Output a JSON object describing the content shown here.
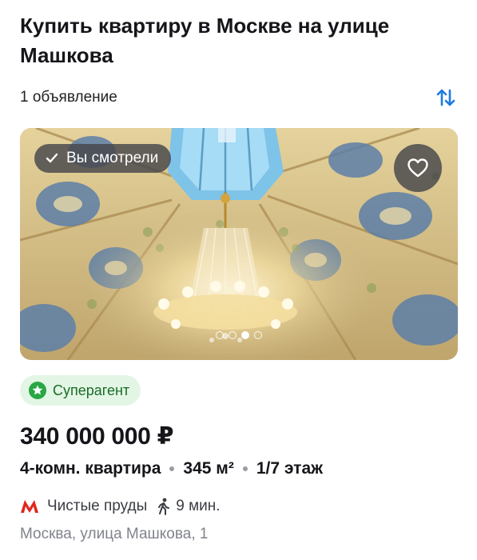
{
  "header": {
    "title": "Купить квартиру в Москве на улице Машкова",
    "count": "1 объявление"
  },
  "listing": {
    "seen_label": "Вы смотрели",
    "photo_dots_total": 4,
    "photo_dots_active": 2,
    "agent_badge": "Суперагент",
    "price": "340 000 000 ₽",
    "rooms": "4-комн. квартира",
    "area": "345 м²",
    "floor": "1/7 этаж",
    "metro_station": "Чистые пруды",
    "walk_time": "9 мин.",
    "address": "Москва, улица Машкова, 1"
  },
  "icons": {
    "sort": "sort-arrows-icon",
    "seen": "check-icon",
    "favorite": "heart-icon",
    "agent": "star-icon",
    "metro": "metro-icon",
    "walk": "walking-person-icon"
  },
  "colors": {
    "accent": "#1f7ae0",
    "metro": "#e3261d",
    "agent_bg": "#e3f6e5",
    "agent_text": "#1a6b28"
  }
}
